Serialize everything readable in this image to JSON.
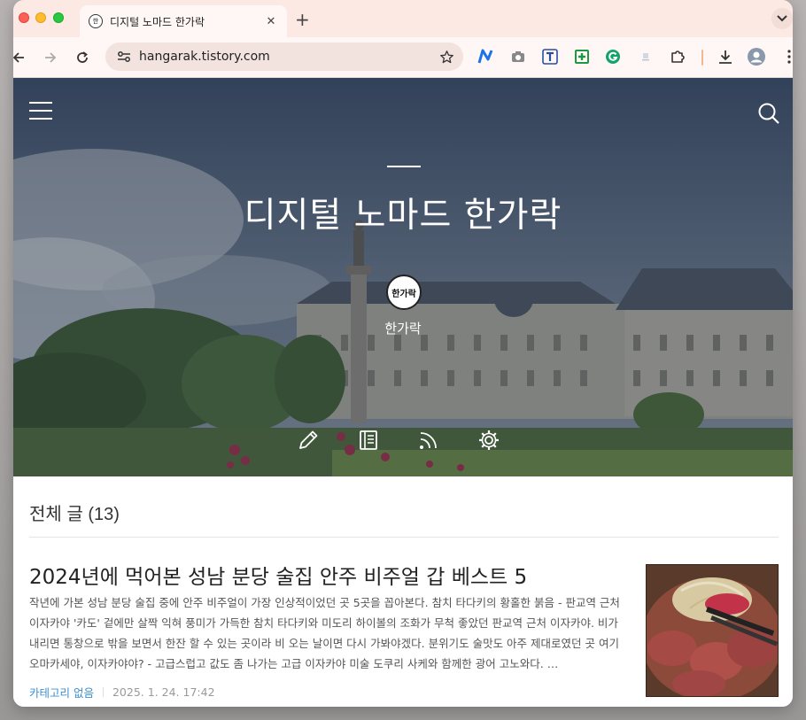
{
  "browser": {
    "tab": {
      "title": "디지털 노마드 한가락",
      "favicon_text": "한"
    },
    "new_tab_label": "+",
    "url": "hangarak.tistory.com",
    "icons": {
      "back": "arrow-left-icon",
      "forward": "arrow-right-icon",
      "reload": "reload-icon",
      "site_info": "tune-icon",
      "bookmark": "star-icon"
    },
    "extensions": [
      "n-ext-icon",
      "camera-icon",
      "text-t-icon",
      "plus-square-icon",
      "grammarly-icon",
      "small-ext-icon",
      "puzzle-icon",
      "download-icon",
      "profile-icon",
      "kebab-menu-icon"
    ]
  },
  "hero": {
    "blog_title": "디지털 노마드 한가락",
    "avatar_text": "한가락",
    "blogger_name": "한가락",
    "actions": [
      "pencil-icon",
      "book-icon",
      "rss-icon",
      "gear-icon"
    ]
  },
  "content": {
    "section_title": "전체 글 (13)",
    "post": {
      "title": "2024년에 먹어본 성남 분당 술집 안주 비주얼 갑 베스트 5",
      "excerpt": "작년에 가본 성남 분당 술집 중에 안주 비주얼이 가장 인상적이었던 곳 5곳을 꼽아본다. 참치 타다키의 황홀한 붉음 - 판교역 근처 이자카야 '카도'   겉에만 살짝 익혀 풍미가 가득한 참치 타다키와 미도리 하이볼의 조화가 무척 좋았던 판교역 근처 이자카야. 비가 내리면 통창으로 밖을 보면서 한잔 할 수 있는 곳이라 비 오는 날이면 다시 가봐야겠다. 분위기도 술맛도 아주 제대로였던 곳  여기 오마카세야, 이자카야야? - 고급스럽고 값도 좀 나가는 고급 이자카야 미술  도쿠리 사케와 함께한 광어 고노와다. …",
      "category": "카테고리 없음",
      "date": "2025. 1. 24. 17:42"
    }
  },
  "colors": {
    "tabstrip": "#fce9e3",
    "toolbar": "#fff7f5",
    "accent_link": "#3d8fd4"
  }
}
